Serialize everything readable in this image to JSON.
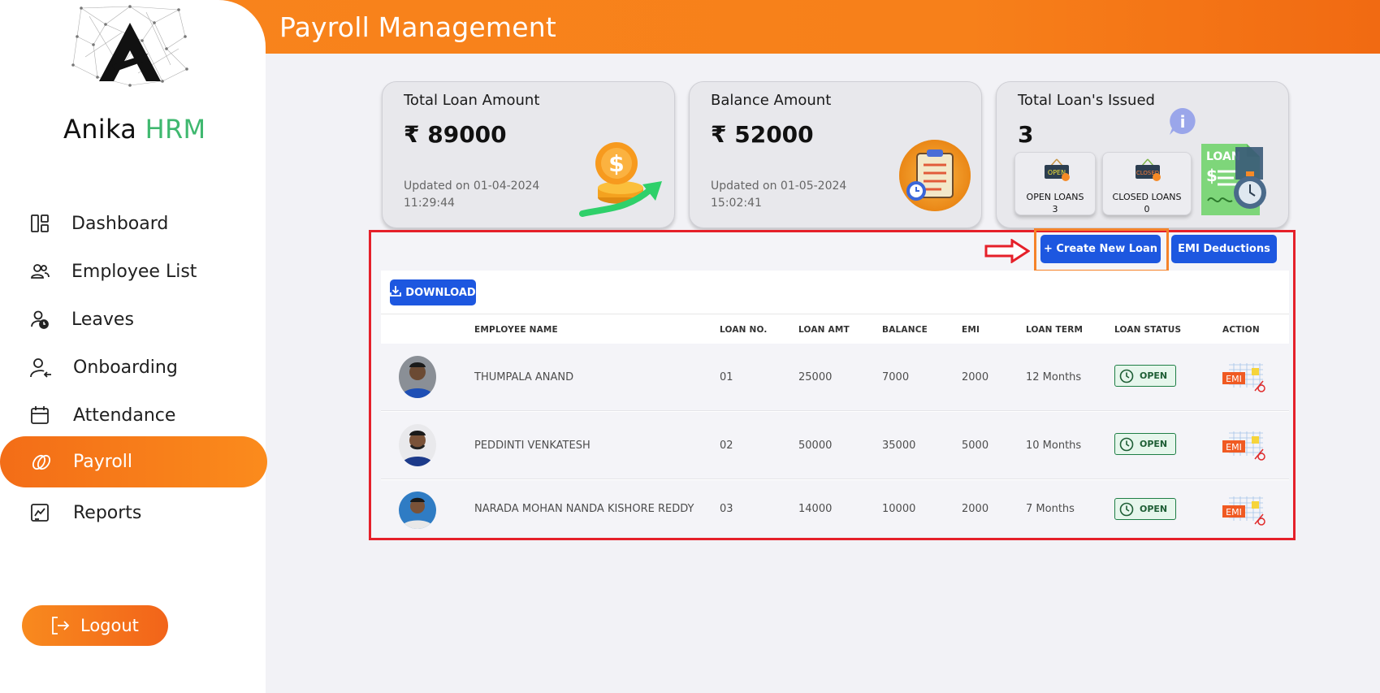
{
  "header": {
    "title": "Payroll Management"
  },
  "brand": {
    "name_part1": "Anika",
    "name_part2": "HRM"
  },
  "sidebar": {
    "items": [
      {
        "label": "Dashboard",
        "icon": "dashboard-icon"
      },
      {
        "label": "Employee List",
        "icon": "employees-icon"
      },
      {
        "label": "Leaves",
        "icon": "leaves-icon"
      },
      {
        "label": "Onboarding",
        "icon": "onboarding-icon"
      },
      {
        "label": "Attendance",
        "icon": "calendar-icon"
      },
      {
        "label": "Payroll",
        "icon": "payroll-icon",
        "active": true
      },
      {
        "label": "Reports",
        "icon": "reports-icon"
      }
    ],
    "logout_label": "Logout"
  },
  "cards": {
    "total_loan": {
      "title": "Total Loan Amount",
      "value": "₹ 89000",
      "updated_line1": "Updated on 01-04-2024",
      "updated_line2": "11:29:44"
    },
    "balance": {
      "title": "Balance Amount",
      "value": "₹ 52000",
      "updated_line1": "Updated on 01-05-2024",
      "updated_line2": "15:02:41"
    },
    "issued": {
      "title": "Total Loan's Issued",
      "value": "3",
      "open": {
        "label": "OPEN LOANS",
        "count": "3",
        "sign": "OPEN"
      },
      "closed": {
        "label": "CLOSED LOANS",
        "count": "0",
        "sign": "CLOSED"
      },
      "loan_word": "LOAN"
    }
  },
  "actions": {
    "create_label": "+ Create New Loan",
    "emi_label": "EMI Deductions",
    "download_label": "DOWNLOAD"
  },
  "table": {
    "columns": [
      "EMPLOYEE NAME",
      "LOAN NO.",
      "LOAN AMT",
      "BALANCE",
      "EMI",
      "LOAN TERM",
      "LOAN STATUS",
      "ACTION"
    ],
    "rows": [
      {
        "name": "THUMPALA ANAND",
        "loan_no": "01",
        "amount": "25000",
        "balance": "7000",
        "emi": "2000",
        "term": "12 Months",
        "status": "OPEN"
      },
      {
        "name": "PEDDINTI VENKATESH",
        "loan_no": "02",
        "amount": "50000",
        "balance": "35000",
        "emi": "5000",
        "term": "10 Months",
        "status": "OPEN"
      },
      {
        "name": "NARADA MOHAN NANDA KISHORE REDDY",
        "loan_no": "03",
        "amount": "14000",
        "balance": "10000",
        "emi": "2000",
        "term": "7 Months",
        "status": "OPEN"
      }
    ],
    "action_icon_text": "EMI"
  },
  "colors": {
    "accent": "#f7801a",
    "primary_button": "#1d57e0",
    "highlight_red": "#e5202a",
    "status_green": "#1e7e45",
    "brand_green": "#3fb86f"
  }
}
